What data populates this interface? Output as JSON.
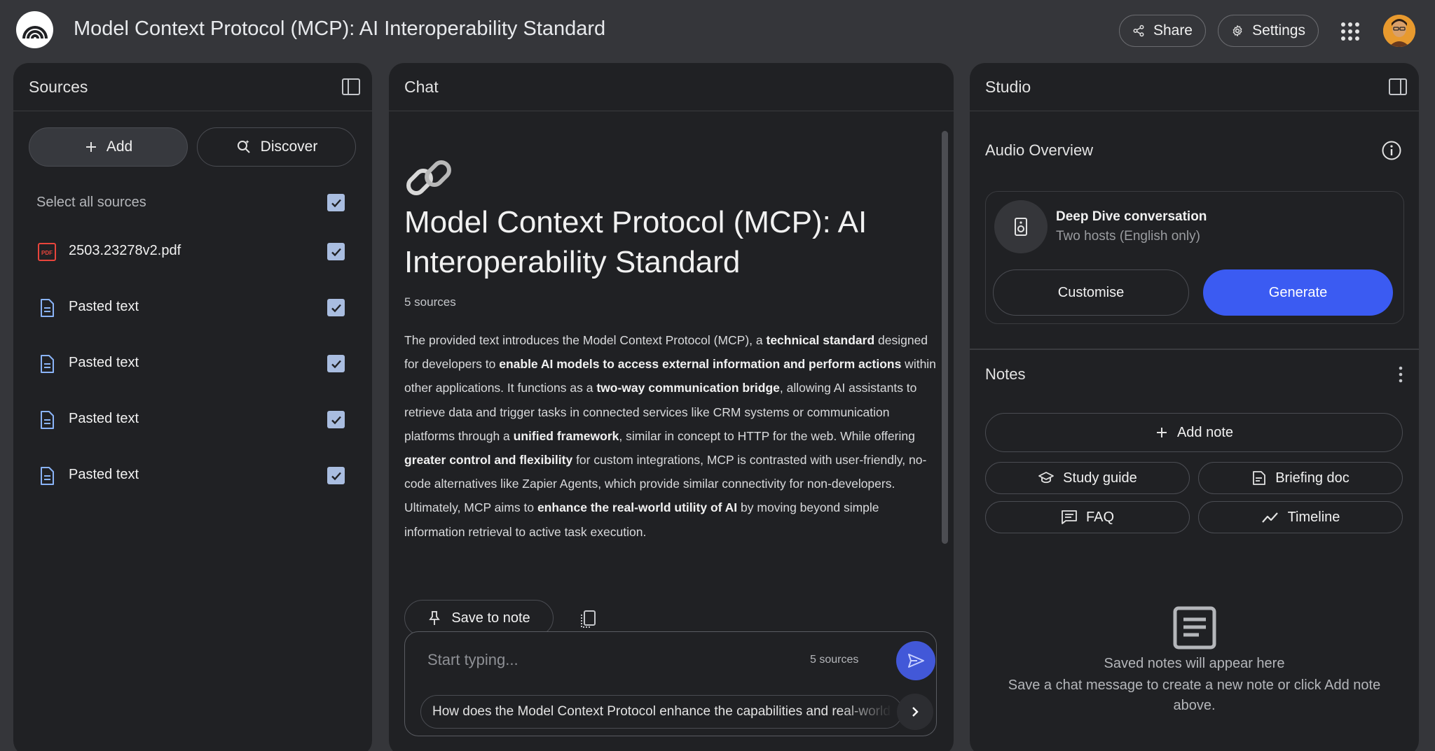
{
  "app": {
    "title": "Model Context Protocol (MCP): AI Interoperability Standard",
    "share_label": "Share",
    "settings_label": "Settings"
  },
  "sources": {
    "title": "Sources",
    "add_label": "Add",
    "discover_label": "Discover",
    "select_all_label": "Select all sources",
    "items": [
      {
        "label": "2503.23278v2.pdf",
        "icon": "pdf-icon",
        "checked": true
      },
      {
        "label": "Pasted text",
        "icon": "document-icon",
        "checked": true
      },
      {
        "label": "Pasted text",
        "icon": "document-icon",
        "checked": true
      },
      {
        "label": "Pasted text",
        "icon": "document-icon",
        "checked": true
      },
      {
        "label": "Pasted text",
        "icon": "document-icon",
        "checked": true
      }
    ]
  },
  "chat": {
    "title": "Chat",
    "notebook_title": "Model Context Protocol (MCP): AI Interoperability Standard",
    "source_count": "5 sources",
    "summary": [
      {
        "text": "The provided text introduces the Model Context Protocol (MCP), a ",
        "bold": false
      },
      {
        "text": "technical standard",
        "bold": true
      },
      {
        "text": " designed for developers to ",
        "bold": false
      },
      {
        "text": "enable AI models to access external information and perform actions",
        "bold": true
      },
      {
        "text": " within other applications. It functions as a ",
        "bold": false
      },
      {
        "text": "two-way communication bridge",
        "bold": true
      },
      {
        "text": ", allowing AI assistants to retrieve data and trigger tasks in connected services like CRM systems or communication platforms through a ",
        "bold": false
      },
      {
        "text": "unified framework",
        "bold": true
      },
      {
        "text": ", similar in concept to HTTP for the web. While offering ",
        "bold": false
      },
      {
        "text": "greater control and flexibility",
        "bold": true
      },
      {
        "text": " for custom integrations, MCP is contrasted with user-friendly, no-code alternatives like Zapier Agents, which provide similar connectivity for non-developers. Ultimately, MCP aims to ",
        "bold": false
      },
      {
        "text": "enhance the real-world utility of AI",
        "bold": true
      },
      {
        "text": " by moving beyond simple information retrieval to active task execution.",
        "bold": false
      }
    ],
    "save_note_label": "Save to note",
    "input_placeholder": "Start typing...",
    "input_source_count": "5 sources",
    "suggestion": "How does the Model Context Protocol enhance the capabilities and real-world utility of AI?"
  },
  "studio": {
    "title": "Studio",
    "audio_overview_title": "Audio Overview",
    "audio_card": {
      "title": "Deep Dive conversation",
      "subtitle": "Two hosts (English only)",
      "customise_label": "Customise",
      "generate_label": "Generate"
    },
    "notes_title": "Notes",
    "add_note_label": "Add note",
    "note_actions": [
      {
        "label": "Study guide",
        "icon": "graduation-cap-icon"
      },
      {
        "label": "Briefing doc",
        "icon": "briefing-doc-icon"
      },
      {
        "label": "FAQ",
        "icon": "faq-icon"
      },
      {
        "label": "Timeline",
        "icon": "timeline-icon"
      }
    ],
    "empty_title": "Saved notes will appear here",
    "empty_subtitle": "Save a chat message to create a new note or click Add note above."
  },
  "colors": {
    "background": "#35363a",
    "panel": "#202124",
    "accent": "#3b5bf2",
    "checkbox": "#a9bde0",
    "pdf_red": "#e8453c",
    "doc_blue": "#8ab4f8"
  }
}
